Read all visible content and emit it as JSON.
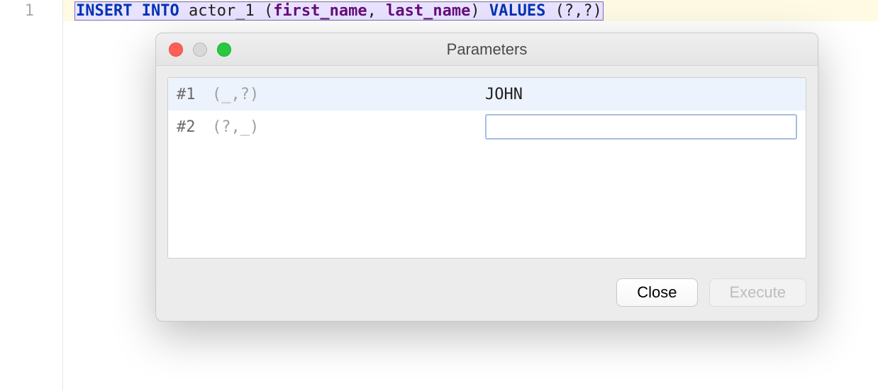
{
  "editor": {
    "line_number": "1",
    "sql": {
      "kw_insert": "INSERT",
      "kw_into": "INTO",
      "table": "actor_1",
      "open_paren1": "(",
      "col1": "first_name",
      "comma1": ", ",
      "col2": "last_name",
      "close_paren1": ")",
      "kw_values": "VALUES",
      "open_paren2": "(",
      "q1": "?",
      "comma2": ",",
      "q2": "?",
      "close_paren2": ")"
    }
  },
  "dialog": {
    "title": "Parameters",
    "params": [
      {
        "num": "#1",
        "hint": "(_,?)",
        "value": "JOHN"
      },
      {
        "num": "#2",
        "hint": "(?,_)",
        "value": ""
      }
    ],
    "buttons": {
      "close": "Close",
      "execute": "Execute"
    }
  }
}
